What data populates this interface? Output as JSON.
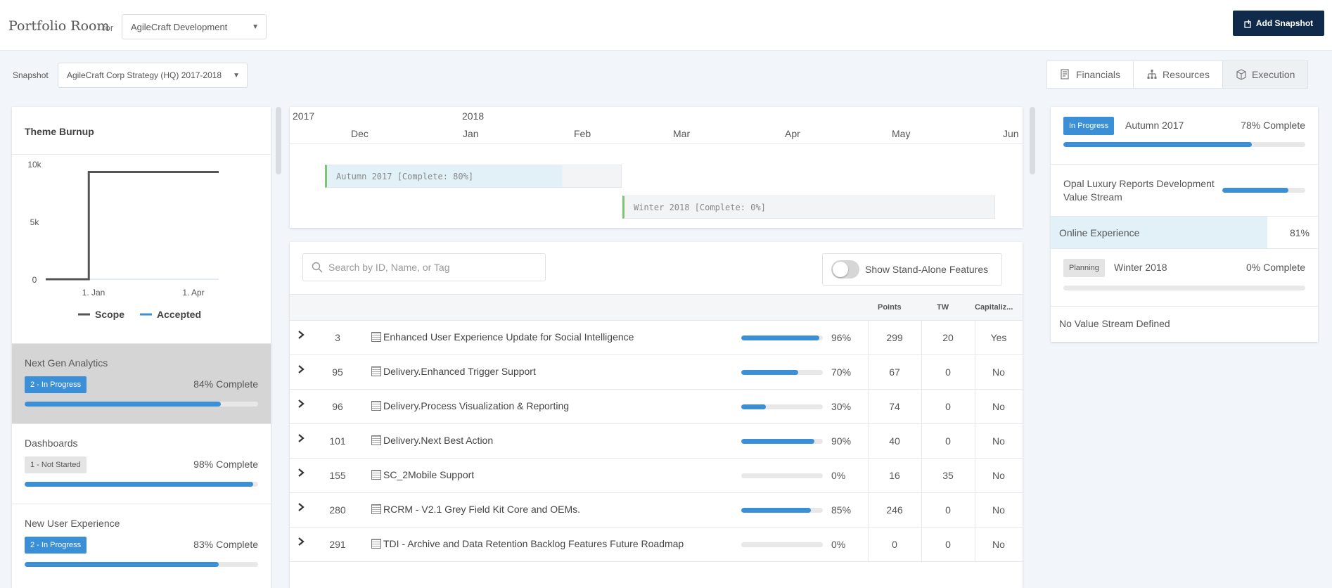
{
  "header": {
    "title": "Portfolio Room",
    "for_label": "for",
    "org_select": "AgileCraft Development",
    "add_snapshot": "Add Snapshot"
  },
  "snapshot": {
    "label": "Snapshot",
    "value": "AgileCraft Corp Strategy (HQ) 2017-2018"
  },
  "tabs": [
    {
      "label": "Financials",
      "icon": "financials-icon",
      "active": false
    },
    {
      "label": "Resources",
      "icon": "resources-icon",
      "active": false
    },
    {
      "label": "Execution",
      "icon": "cube-icon",
      "active": true
    }
  ],
  "burnup": {
    "title": "Theme Burnup",
    "y_ticks": [
      "10k",
      "5k",
      "0"
    ],
    "x_ticks": [
      "1. Jan",
      "1. Apr"
    ],
    "legend": [
      {
        "label": "Scope",
        "color": "#555555"
      },
      {
        "label": "Accepted",
        "color": "#3a8fd6"
      }
    ]
  },
  "chart_data": {
    "type": "line",
    "title": "Theme Burnup",
    "xlabel": "",
    "ylabel": "",
    "x_ticks": [
      "1. Jan",
      "1. Apr"
    ],
    "ylim": [
      0,
      10000
    ],
    "series": [
      {
        "name": "Scope",
        "points": [
          [
            "2017-11-01",
            0
          ],
          [
            "2017-12-31",
            0
          ],
          [
            "2017-12-31",
            9300
          ],
          [
            "2018-06-30",
            9300
          ]
        ]
      },
      {
        "name": "Accepted",
        "points": []
      }
    ],
    "legend_position": "bottom"
  },
  "themes": [
    {
      "name": "Next Gen Analytics",
      "badge": "2 - In Progress",
      "badge_type": "blue",
      "percent": "84% Complete",
      "progress": 0.84,
      "selected": true
    },
    {
      "name": "Dashboards",
      "badge": "1 - Not Started",
      "badge_type": "grey",
      "percent": "98% Complete",
      "progress": 0.98,
      "selected": false
    },
    {
      "name": "New User Experience",
      "badge": "2 - In Progress",
      "badge_type": "blue",
      "percent": "83% Complete",
      "progress": 0.83,
      "selected": false
    }
  ],
  "timeline": {
    "years": [
      "2017",
      "2018"
    ],
    "months": [
      "Dec",
      "Jan",
      "Feb",
      "Mar",
      "Apr",
      "May",
      "Jun"
    ],
    "bars": [
      {
        "label": "Autumn 2017 [Complete: 80%]",
        "progress": 0.8
      },
      {
        "label": "Winter 2018 [Complete: 0%]",
        "progress": 0
      }
    ]
  },
  "search": {
    "placeholder": "Search by ID, Name, or Tag"
  },
  "toggle": {
    "label": "Show Stand-Alone Features",
    "on": false
  },
  "table": {
    "columns": {
      "points": "Points",
      "tw": "TW",
      "cap": "Capitaliz..."
    },
    "rows": [
      {
        "id": "3",
        "name": "Enhanced User Experience Update for Social Intelligence",
        "pct": "96%",
        "progress": 0.96,
        "points": "299",
        "tw": "20",
        "cap": "Yes"
      },
      {
        "id": "95",
        "name": "Delivery.Enhanced Trigger Support",
        "pct": "70%",
        "progress": 0.7,
        "points": "67",
        "tw": "0",
        "cap": "No"
      },
      {
        "id": "96",
        "name": "Delivery.Process Visualization & Reporting",
        "pct": "30%",
        "progress": 0.3,
        "points": "74",
        "tw": "0",
        "cap": "No"
      },
      {
        "id": "101",
        "name": "Delivery.Next Best Action",
        "pct": "90%",
        "progress": 0.9,
        "points": "40",
        "tw": "0",
        "cap": "No"
      },
      {
        "id": "155",
        "name": "SC_2Mobile Support",
        "pct": "0%",
        "progress": 0,
        "points": "16",
        "tw": "35",
        "cap": "No"
      },
      {
        "id": "280",
        "name": "RCRM - V2.1 Grey Field Kit Core and OEMs.",
        "pct": "85%",
        "progress": 0.85,
        "points": "246",
        "tw": "0",
        "cap": "No"
      },
      {
        "id": "291",
        "name": "TDI - Archive and Data Retention Backlog Features Future Roadmap",
        "pct": "0%",
        "progress": 0,
        "points": "0",
        "tw": "0",
        "cap": "No"
      }
    ]
  },
  "right_panel": {
    "pi1": {
      "badge": "In Progress",
      "name": "Autumn 2017",
      "percent": "78% Complete",
      "progress": 0.78
    },
    "value_stream": {
      "name": "Opal Luxury Reports Development Value Stream",
      "progress": 0.8
    },
    "online": {
      "name": "Online Experience",
      "percent": "81%",
      "progress": 0.81
    },
    "pi2": {
      "badge": "Planning",
      "name": "Winter 2018",
      "percent": "0% Complete",
      "progress": 0
    },
    "no_vs": "No Value Stream Defined"
  },
  "colors": {
    "accent": "#3a8fd6",
    "header_button": "#102a4c",
    "milestone": "#7cc576"
  }
}
